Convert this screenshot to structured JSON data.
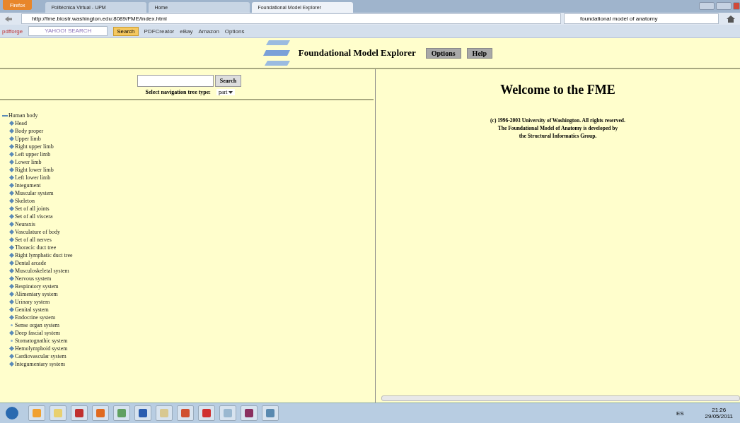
{
  "browser": {
    "menu_button": "Firefox",
    "tabs": [
      {
        "label": "Politécnica Virtual - UPM",
        "selected": false
      },
      {
        "label": "Home",
        "selected": false
      },
      {
        "label": "Foundational Model Explorer",
        "selected": true
      }
    ],
    "address": "http://fme.biostr.washington.edu:8089/FME/index.html",
    "search_value": "foundational model of anatomy",
    "bookmarks": {
      "brand": "pdfforge",
      "search_logo": "YAHOO! SEARCH",
      "search_button": "Search",
      "links": [
        "PDFCreator",
        "eBay",
        "Amazon",
        "Options"
      ]
    }
  },
  "header": {
    "title": "Foundational Model Explorer",
    "buttons": [
      "Options",
      "Help"
    ]
  },
  "left": {
    "search_button": "Search",
    "tree_type_label": "Select navigation tree type:",
    "tree_type_value": "part",
    "tree": [
      {
        "label": "Human body",
        "expanded": true,
        "children": [
          {
            "label": "Head",
            "expandable": true
          },
          {
            "label": "Body proper",
            "expandable": true
          },
          {
            "label": "Upper limb",
            "expandable": true
          },
          {
            "label": "Right upper limb",
            "expandable": true
          },
          {
            "label": "Left upper limb",
            "expandable": true
          },
          {
            "label": "Lower limb",
            "expandable": true
          },
          {
            "label": "Right lower limb",
            "expandable": true
          },
          {
            "label": "Left lower limb",
            "expandable": true
          },
          {
            "label": "Integument",
            "expandable": true
          },
          {
            "label": "Muscular system",
            "expandable": true
          },
          {
            "label": "Skeleton",
            "expandable": true
          },
          {
            "label": "Set of all joints",
            "expandable": true
          },
          {
            "label": "Set of all viscera",
            "expandable": true
          },
          {
            "label": "Neuraxis",
            "expandable": true
          },
          {
            "label": "Vasculature of body",
            "expandable": true
          },
          {
            "label": "Set of all nerves",
            "expandable": true
          },
          {
            "label": "Thoracic duct tree",
            "expandable": true
          },
          {
            "label": "Right lymphatic duct tree",
            "expandable": true
          },
          {
            "label": "Dental arcade",
            "expandable": true
          },
          {
            "label": "Musculoskeletal system",
            "expandable": true
          },
          {
            "label": "Nervous system",
            "expandable": true
          },
          {
            "label": "Respiratory system",
            "expandable": true
          },
          {
            "label": "Alimentary system",
            "expandable": true
          },
          {
            "label": "Urinary system",
            "expandable": true
          },
          {
            "label": "Genital system",
            "expandable": true
          },
          {
            "label": "Endocrine system",
            "expandable": true
          },
          {
            "label": "Sense organ system",
            "expandable": false
          },
          {
            "label": "Deep fascial system",
            "expandable": true
          },
          {
            "label": "Stomatognathic system",
            "expandable": false
          },
          {
            "label": "Hemolymphoid system",
            "expandable": true
          },
          {
            "label": "Cardiovascular system",
            "expandable": true
          },
          {
            "label": "Integumentary system",
            "expandable": true
          }
        ]
      }
    ]
  },
  "right": {
    "heading": "Welcome to the FME",
    "notice": [
      "(c) 1996-2003 University of Washington. All rights reserved.",
      "The Foundational Model of Anatomy is developed by",
      "the Structural Informatics Group."
    ]
  },
  "taskbar": {
    "language": "ES",
    "time": "21:26",
    "date": "29/05/2011"
  }
}
